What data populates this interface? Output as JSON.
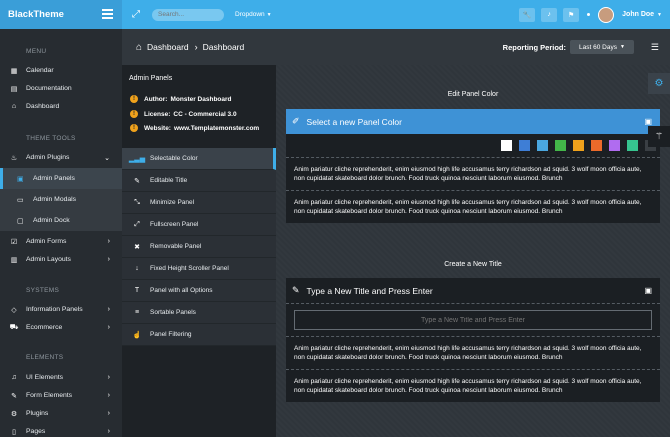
{
  "brand": {
    "name": "BlackTheme",
    "menu_icon": "hamburger-icon"
  },
  "topbar": {
    "search_placeholder": "Search...",
    "dropdown_label": "Dropdown",
    "user_name": "John Doe",
    "icons": [
      "expand-icon",
      "wrench-icon",
      "bell-icon",
      "flag-icon"
    ],
    "accent": "#3eaee9"
  },
  "breadcrumb": {
    "items": [
      "Dashboard",
      "Dashboard"
    ],
    "period_label": "Reporting Period:",
    "period_value": "Last 60 Days"
  },
  "sidebar": {
    "headings": [
      "MENU",
      "THEME TOOLS",
      "SYSTEMS",
      "ELEMENTS"
    ],
    "menu": [
      {
        "label": "Calendar",
        "icon": "calendar-icon"
      },
      {
        "label": "Documentation",
        "icon": "book-icon"
      },
      {
        "label": "Dashboard",
        "icon": "home-icon"
      }
    ],
    "theme_tools": [
      {
        "label": "Admin Plugins",
        "icon": "fire-icon"
      },
      {
        "label": "Admin Panels",
        "icon": "panel-icon"
      },
      {
        "label": "Admin Modals",
        "icon": "modal-icon"
      },
      {
        "label": "Admin Dock",
        "icon": "dock-icon"
      },
      {
        "label": "Admin Forms",
        "icon": "check-icon"
      },
      {
        "label": "Admin Layouts",
        "icon": "columns-icon"
      }
    ],
    "systems": [
      {
        "label": "Information Panels",
        "icon": "diamond-icon"
      },
      {
        "label": "Ecommerce",
        "icon": "cart-icon"
      }
    ],
    "elements": [
      {
        "label": "UI Elements",
        "icon": "bell-icon"
      },
      {
        "label": "Form Elements",
        "icon": "form-icon"
      },
      {
        "label": "Plugins",
        "icon": "plugin-icon"
      },
      {
        "label": "Pages",
        "icon": "page-icon"
      }
    ]
  },
  "left_panel": {
    "title": "Admin Panels",
    "info": [
      {
        "key": "Author:",
        "value": "Monster Dashboard"
      },
      {
        "key": "License:",
        "value": "CC - Commercial 3.0"
      },
      {
        "key": "Website:",
        "value": "www.Templatemonster.com"
      }
    ],
    "items": [
      {
        "label": "Selectable Color",
        "icon": "chart-icon"
      },
      {
        "label": "Editable Title",
        "icon": "pencil-icon"
      },
      {
        "label": "Minimize Panel",
        "icon": "compress-icon"
      },
      {
        "label": "Fullscreen Panel",
        "icon": "expand-icon"
      },
      {
        "label": "Removable Panel",
        "icon": "close-icon"
      },
      {
        "label": "Fixed Height Scroller Panel",
        "icon": "arrow-down-icon"
      },
      {
        "label": "Panel with all Options",
        "icon": "text-icon"
      },
      {
        "label": "Sortable Panels",
        "icon": "list-icon"
      },
      {
        "label": "Panel Filtering",
        "icon": "hand-icon"
      }
    ]
  },
  "content": {
    "section1_title": "Edit Panel Color",
    "panel1_title": "Select a new Panel Color",
    "swatches": [
      "#ffffff",
      "#3e7ed6",
      "#4aa7df",
      "#43b649",
      "#f0a21c",
      "#ec6a2a",
      "#b06cf0",
      "#36c48f",
      "#3a3f44"
    ],
    "para1": "Anim pariatur cliche reprehenderit, enim eiusmod high life accusamus terry richardson ad squid. 3 wolf moon officia aute, non cupidatat skateboard dolor brunch. Food truck quinoa nesciunt laborum eiusmod. Brunch",
    "para2": "Anim pariatur cliche reprehenderit, enim eiusmod high life accusamus terry richardson ad squid. 3 wolf moon officia aute, non cupidatat skateboard dolor brunch. Food truck quinoa nesciunt laborum eiusmod. Brunch",
    "section2_title": "Create a New Title",
    "panel2_title": "Type a New Title and Press Enter",
    "input_placeholder": "Type a New Title and Press Enter",
    "para3": "Anim pariatur cliche reprehenderit, enim eiusmod high life accusamus terry richardson ad squid. 3 wolf moon officia aute, non cupidatat skateboard dolor brunch. Food truck quinoa nesciunt laborum eiusmod. Brunch",
    "para4": "Anim pariatur cliche reprehenderit, enim eiusmod high life accusamus terry richardson ad squid. 3 wolf moon officia aute, non cupidatat skateboard dolor brunch. Food truck quinoa nesciunt laborum eiusmod. Brunch"
  }
}
